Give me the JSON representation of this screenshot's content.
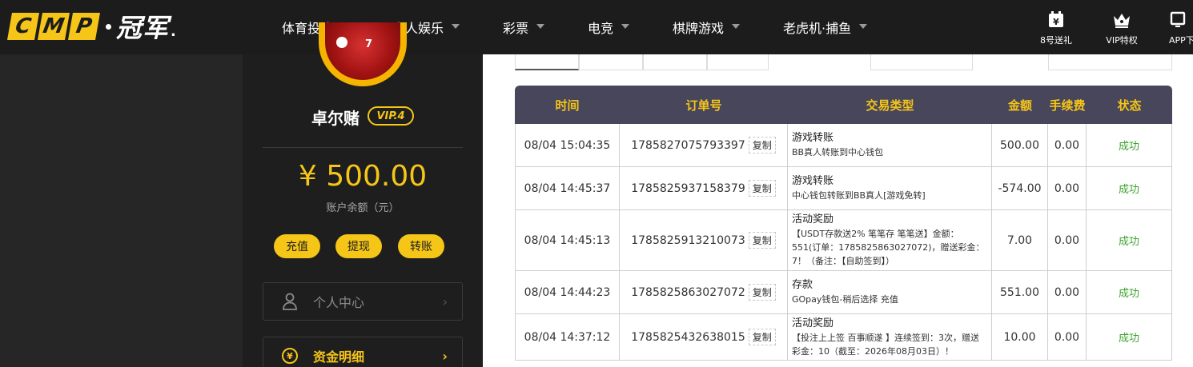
{
  "brand": {
    "logo_letters": [
      "C",
      "M",
      "P"
    ],
    "logo_cn": "冠军",
    "logo_tail": "."
  },
  "nav": [
    {
      "label": "体育投注"
    },
    {
      "label": "真人娱乐"
    },
    {
      "label": "彩票"
    },
    {
      "label": "电竞"
    },
    {
      "label": "棋牌游戏"
    },
    {
      "label": "老虎机·捕鱼"
    }
  ],
  "tools": [
    {
      "label": "8号送礼",
      "icon": "gift-yen-icon"
    },
    {
      "label": "VIP特权",
      "icon": "crown-icon"
    },
    {
      "label": "APP下",
      "icon": "monitor-icon"
    }
  ],
  "profile": {
    "name": "卓尔赌",
    "vip": "VIP.4",
    "avatar_number": "7",
    "balance": "¥ 500.00",
    "balance_label": "账户余额（元）",
    "actions": [
      "充值",
      "提现",
      "转账"
    ]
  },
  "menu": [
    {
      "label": "个人中心",
      "arrow": "›",
      "icon": "user-icon",
      "active": false
    },
    {
      "label": "资金明细",
      "arrow": "›",
      "icon": "yen-cycle-icon",
      "active": true
    }
  ],
  "table": {
    "headers": [
      "时间",
      "订单号",
      "交易类型",
      "金额",
      "手续费",
      "状态"
    ],
    "copy_label": "复制",
    "rows": [
      {
        "time": "08/04 15:04:35",
        "order": "1785827075793397",
        "type_title": "游戏转账",
        "type_desc": "BB真人转账到中心钱包",
        "amount": "500.00",
        "fee": "0.00",
        "status": "成功"
      },
      {
        "time": "08/04 14:45:37",
        "order": "1785825937158379",
        "type_title": "游戏转账",
        "type_desc": "中心钱包转账到BB真人[游戏免转]",
        "amount": "-574.00",
        "fee": "0.00",
        "status": "成功"
      },
      {
        "time": "08/04 14:45:13",
        "order": "1785825913210073",
        "type_title": "活动奖励",
        "type_desc": "【USDT存款送2% 笔笔存 笔笔送】金额：551(订单：1785825863027072)，赠送彩金：7！（备注：【自助签到】）",
        "amount": "7.00",
        "fee": "0.00",
        "status": "成功"
      },
      {
        "time": "08/04 14:44:23",
        "order": "1785825863027072",
        "type_title": "存款",
        "type_desc": "GOpay钱包-稍后选择 充值",
        "amount": "551.00",
        "fee": "0.00",
        "status": "成功"
      },
      {
        "time": "08/04 14:37:12",
        "order": "1785825432638015",
        "type_title": "活动奖励",
        "type_desc": "【投注上上签 百事顺遂 】连续签到：3次，赠送彩金：10（截至：2026年08月03日）！",
        "amount": "10.00",
        "fee": "0.00",
        "status": "成功"
      }
    ]
  },
  "colors": {
    "accent": "#f5c518",
    "header_bg": "#1c1c1c",
    "table_head": "#48465a",
    "success": "#3aa32a"
  }
}
